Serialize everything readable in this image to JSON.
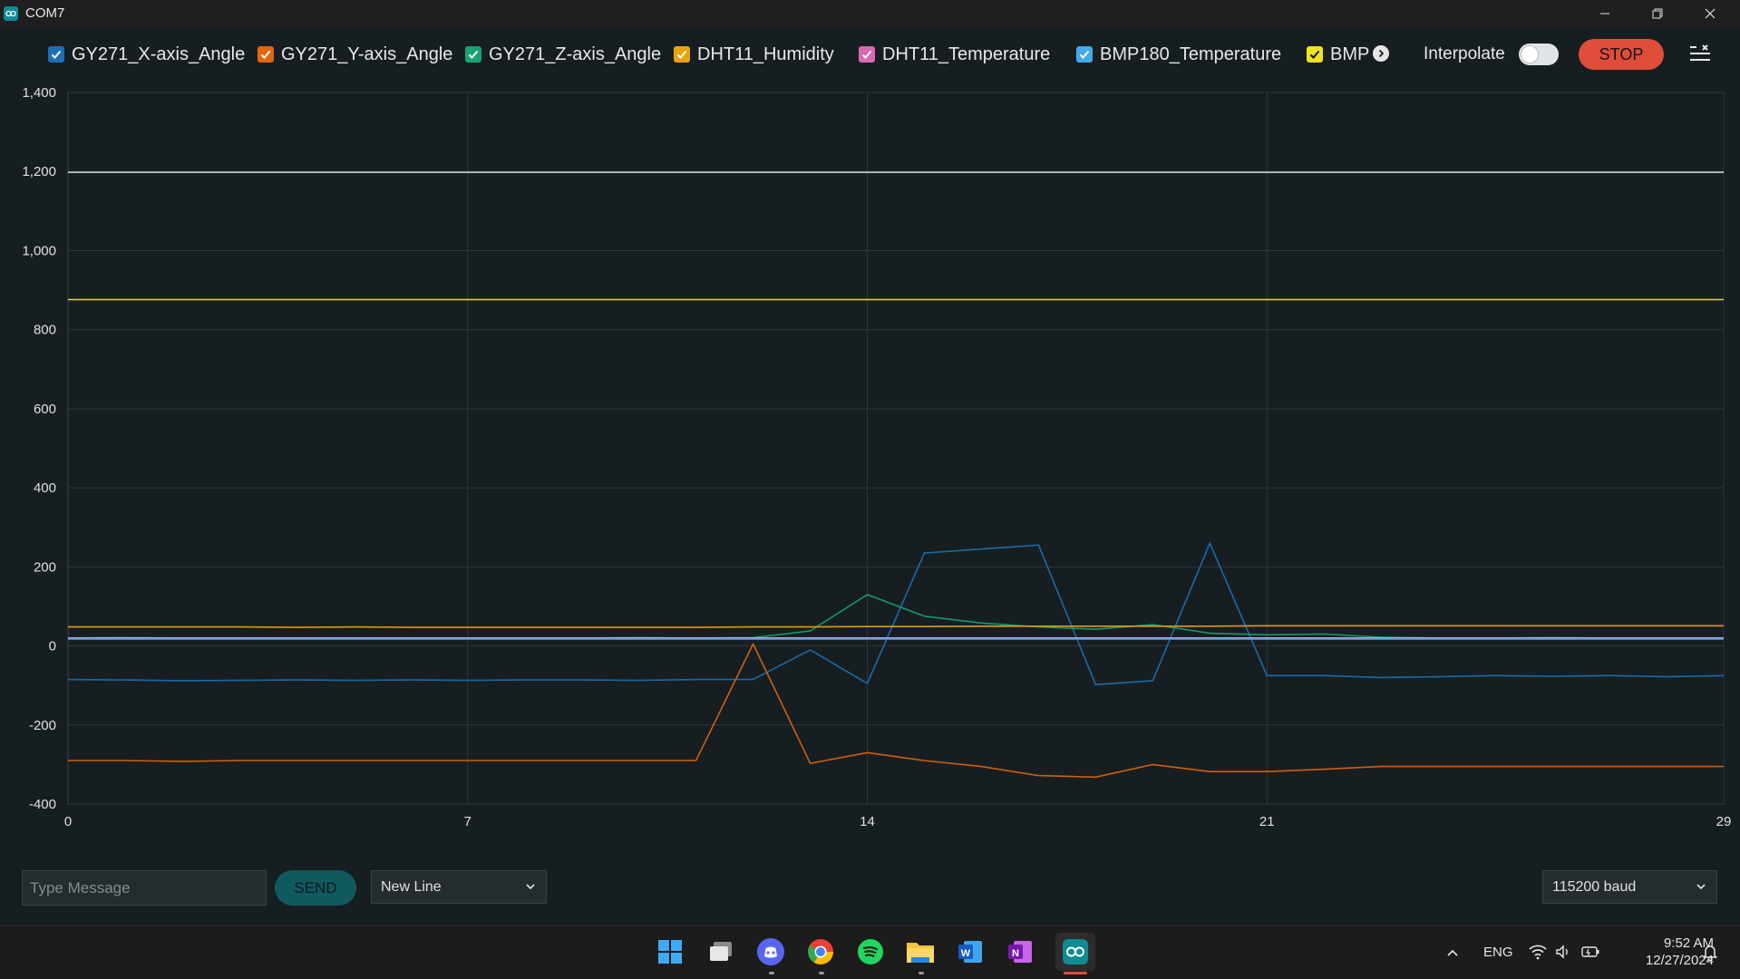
{
  "window": {
    "title": "COM7"
  },
  "legend": {
    "items": [
      {
        "label": "GY271_X-axis_Angle",
        "color": "#1f6fb3",
        "checked": true
      },
      {
        "label": "GY271_Y-axis_Angle",
        "color": "#e0670e",
        "checked": true
      },
      {
        "label": "GY271_Z-axis_Angle",
        "color": "#17a371",
        "checked": true
      },
      {
        "label": "DHT11_Humidity",
        "color": "#e9a30b",
        "checked": true
      },
      {
        "label": "DHT11_Temperature",
        "color": "#d66ab0",
        "checked": true
      },
      {
        "label": "BMP180_Temperature",
        "color": "#43a9e8",
        "checked": true
      },
      {
        "label": "BMP",
        "color": "#f1e21d",
        "checked": true
      }
    ]
  },
  "controls": {
    "interpolate_label": "Interpolate",
    "interpolate_on": false,
    "stop_label": "STOP"
  },
  "chart_data": {
    "type": "line",
    "x": [
      0,
      1,
      2,
      3,
      4,
      5,
      6,
      7,
      8,
      9,
      10,
      11,
      12,
      13,
      14,
      15,
      16,
      17,
      18,
      19,
      20,
      21,
      22,
      23,
      24,
      25,
      26,
      27,
      28,
      29
    ],
    "xlim": [
      0,
      29
    ],
    "ylim": [
      -400,
      1400
    ],
    "x_ticks": [
      "0",
      "7",
      "14",
      "21",
      "29"
    ],
    "y_ticks": [
      "1,400",
      "1,200",
      "1,000",
      "800",
      "600",
      "400",
      "200",
      "0",
      "-200",
      "-400"
    ],
    "grid": true,
    "series": [
      {
        "name": "GY271_X-axis_Angle",
        "color": "#1a6aa8",
        "values": [
          -85,
          -86,
          -88,
          -87,
          -86,
          -87,
          -86,
          -87,
          -86,
          -86,
          -87,
          -85,
          -85,
          -10,
          -95,
          235,
          245,
          255,
          -98,
          -88,
          260,
          -75,
          -75,
          -80,
          -78,
          -75,
          -77,
          -75,
          -78,
          -75
        ]
      },
      {
        "name": "GY271_Y-axis_Angle",
        "color": "#cf5f0e",
        "values": [
          -290,
          -290,
          -292,
          -290,
          -290,
          -290,
          -290,
          -290,
          -290,
          -290,
          -290,
          -290,
          5,
          -297,
          -270,
          -290,
          -305,
          -328,
          -332,
          -300,
          -318,
          -318,
          -312,
          -305,
          -305,
          -305,
          -305,
          -305,
          -305,
          -305
        ]
      },
      {
        "name": "GY271_Z-axis_Angle",
        "color": "#15986a",
        "values": [
          20,
          21,
          20,
          20,
          20,
          20,
          20,
          20,
          20,
          20,
          21,
          20,
          21,
          38,
          130,
          75,
          58,
          48,
          42,
          54,
          32,
          28,
          30,
          22,
          20,
          20,
          21,
          20,
          20,
          20
        ]
      },
      {
        "name": "DHT11_Humidity",
        "color": "#e19a0c",
        "values": [
          48,
          48,
          48,
          48,
          47,
          48,
          47,
          47,
          47,
          47,
          47,
          47,
          48,
          48,
          49,
          49,
          50,
          50,
          50,
          50,
          50,
          51,
          51,
          51,
          51,
          51,
          51,
          51,
          51,
          51
        ]
      },
      {
        "name": "DHT11_Temperature",
        "color": "#c7a3de",
        "values": [
          20,
          20,
          20,
          20,
          20,
          20,
          20,
          20,
          20,
          20,
          20,
          20,
          20,
          20,
          20,
          20,
          20,
          20,
          20,
          20,
          20,
          20,
          20,
          20,
          20,
          20,
          20,
          20,
          20,
          20
        ]
      },
      {
        "name": "BMP180_Temperature",
        "color": "#3a9ad3",
        "values": [
          17,
          17,
          17,
          17,
          17,
          17,
          17,
          17,
          17,
          17,
          17,
          17,
          17,
          17,
          17,
          17,
          17,
          17,
          17,
          17,
          17,
          17,
          17,
          17,
          17,
          17,
          17,
          17,
          17,
          17
        ]
      },
      {
        "name": "BMP",
        "color": "#e6d43b",
        "values": [
          876,
          876,
          876,
          876,
          876,
          876,
          876,
          876,
          876,
          876,
          876,
          876,
          876,
          876,
          876,
          876,
          876,
          876,
          876,
          876,
          876,
          876,
          876,
          876,
          876,
          876,
          876,
          876,
          876,
          876
        ]
      },
      {
        "color": "#c8d2d2",
        "values": [
          1198,
          1198,
          1198,
          1198,
          1198,
          1198,
          1198,
          1198,
          1198,
          1198,
          1198,
          1198,
          1198,
          1198,
          1198,
          1198,
          1198,
          1198,
          1198,
          1198,
          1198,
          1198,
          1198,
          1198,
          1198,
          1198,
          1198,
          1198,
          1198,
          1198
        ]
      }
    ]
  },
  "message": {
    "placeholder": "Type Message",
    "value": "",
    "send_label": "SEND",
    "line_ending": "New Line",
    "baud": "115200 baud"
  },
  "taskbar": {
    "language": "ENG",
    "time": "9:52 AM",
    "date": "12/27/2024",
    "apps": [
      "start-icon",
      "task-view-icon",
      "discord-icon",
      "chrome-icon",
      "spotify-icon",
      "file-explorer-icon",
      "word-icon",
      "onenote-icon",
      "arduino-icon"
    ]
  }
}
